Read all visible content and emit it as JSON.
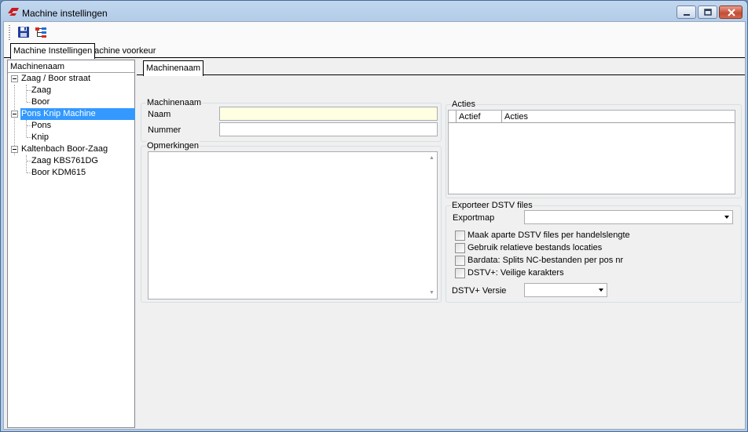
{
  "window": {
    "title": "Machine instellingen",
    "accent": "#cc1a1a"
  },
  "toolbar": {
    "save_icon": "floppy-disk-icon",
    "tree_icon": "tree-structure-icon"
  },
  "outer_tabs": [
    {
      "label": "Machine Instellingen",
      "active": true
    },
    {
      "label": "Machine voorkeur",
      "active": false
    }
  ],
  "tree": {
    "header": "Machinenaam",
    "items": [
      {
        "label": "Zaag / Boor straat",
        "level": 0
      },
      {
        "label": "Zaag",
        "level": 1
      },
      {
        "label": "Boor",
        "level": 1
      },
      {
        "label": "Pons Knip Machine",
        "level": 0,
        "selected": true
      },
      {
        "label": "Pons",
        "level": 1
      },
      {
        "label": "Knip",
        "level": 1
      },
      {
        "label": "Kaltenbach Boor-Zaag",
        "level": 0
      },
      {
        "label": "Zaag KBS761DG",
        "level": 1
      },
      {
        "label": "Boor KDM615",
        "level": 1
      }
    ]
  },
  "inner_tab": "Machinenaam",
  "machinenaam_group": {
    "title": "Machinenaam",
    "naam_label": "Naam",
    "naam_value": "",
    "nummer_label": "Nummer",
    "nummer_value": ""
  },
  "opmerkingen": {
    "title": "Opmerkingen",
    "value": ""
  },
  "acties": {
    "title": "Acties",
    "columns": [
      "Actief",
      "Acties"
    ]
  },
  "exporteer": {
    "title": "Exporteer DSTV files",
    "exportmap_label": "Exportmap",
    "exportmap_value": "",
    "checkboxes": [
      {
        "label": "Maak aparte DSTV files per handelslengte",
        "checked": false
      },
      {
        "label": "Gebruik relatieve bestands locaties",
        "checked": false
      },
      {
        "label": "Bardata: Splits NC-bestanden per pos nr",
        "checked": false
      },
      {
        "label": "DSTV+: Veilige karakters",
        "checked": false
      }
    ],
    "versie_label": "DSTV+ Versie",
    "versie_value": ""
  }
}
